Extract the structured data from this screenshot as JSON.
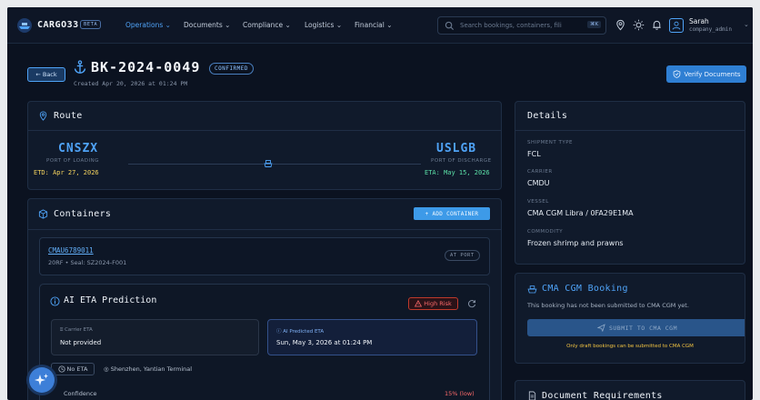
{
  "nav": {
    "brand": "CARGO33",
    "beta": "BETA",
    "menu": [
      {
        "label": "Operations ⌄",
        "active": true
      },
      {
        "label": "Documents ⌄",
        "active": false
      },
      {
        "label": "Compliance ⌄",
        "active": false
      },
      {
        "label": "Logistics ⌄",
        "active": false
      },
      {
        "label": "Financial ⌄",
        "active": false
      }
    ],
    "search_placeholder": "Search bookings, containers, fili",
    "search_shortcut": "⌘K",
    "user_name": "Sarah",
    "user_role": "company_admin"
  },
  "header": {
    "back_label": "← Back",
    "booking_id": "BK-2024-0049",
    "status": "CONFIRMED",
    "created": "Created Apr 20, 2026 at 01:24 PM",
    "verify_label": "Verify Documents"
  },
  "route": {
    "title": "Route",
    "origin_code": "CNSZX",
    "origin_label": "PORT OF LOADING",
    "etd": "ETD: Apr 27, 2026",
    "dest_code": "USLGB",
    "dest_label": "PORT OF DISCHARGE",
    "eta": "ETA: May 15, 2026"
  },
  "details": {
    "title": "Details",
    "fields": [
      {
        "label": "SHIPMENT TYPE",
        "value": "FCL"
      },
      {
        "label": "CARRIER",
        "value": "CMDU"
      },
      {
        "label": "VESSEL",
        "value": "CMA CGM Libra / 0FA29E1MA"
      },
      {
        "label": "COMMODITY",
        "value": "Frozen shrimp and prawns"
      }
    ]
  },
  "containers": {
    "title": "Containers",
    "add_label": "+ ADD CONTAINER",
    "item": {
      "id": "CMAU6789011",
      "meta": "20RF • Seal: SZ2024-F001",
      "status": "AT PORT"
    }
  },
  "ai": {
    "title": "AI ETA Prediction",
    "risk": "High Risk",
    "carrier_label": "Carrier ETA",
    "carrier_value": "Not provided",
    "pred_label": "AI Predicted ETA",
    "pred_value": "Sun, May 3, 2026 at 01:24 PM",
    "no_eta": "No ETA",
    "terminal": "Shenzhen, Yantian Terminal",
    "confidence_label": "Confidence",
    "confidence_value": "15% (low)",
    "confidence_fraction": 0.15
  },
  "cma": {
    "title": "CMA CGM Booking",
    "note": "This booking has not been submitted to CMA CGM yet.",
    "submit_label": "SUBMIT TO CMA CGM",
    "warn": "Only draft bookings can be submitted to CMA CGM"
  },
  "docs": {
    "title": "Document Requirements"
  },
  "colors": {
    "accent": "#4fa3f7",
    "danger": "#ff6b6b",
    "etd": "#f4d35e",
    "eta": "#5ce1a8"
  }
}
